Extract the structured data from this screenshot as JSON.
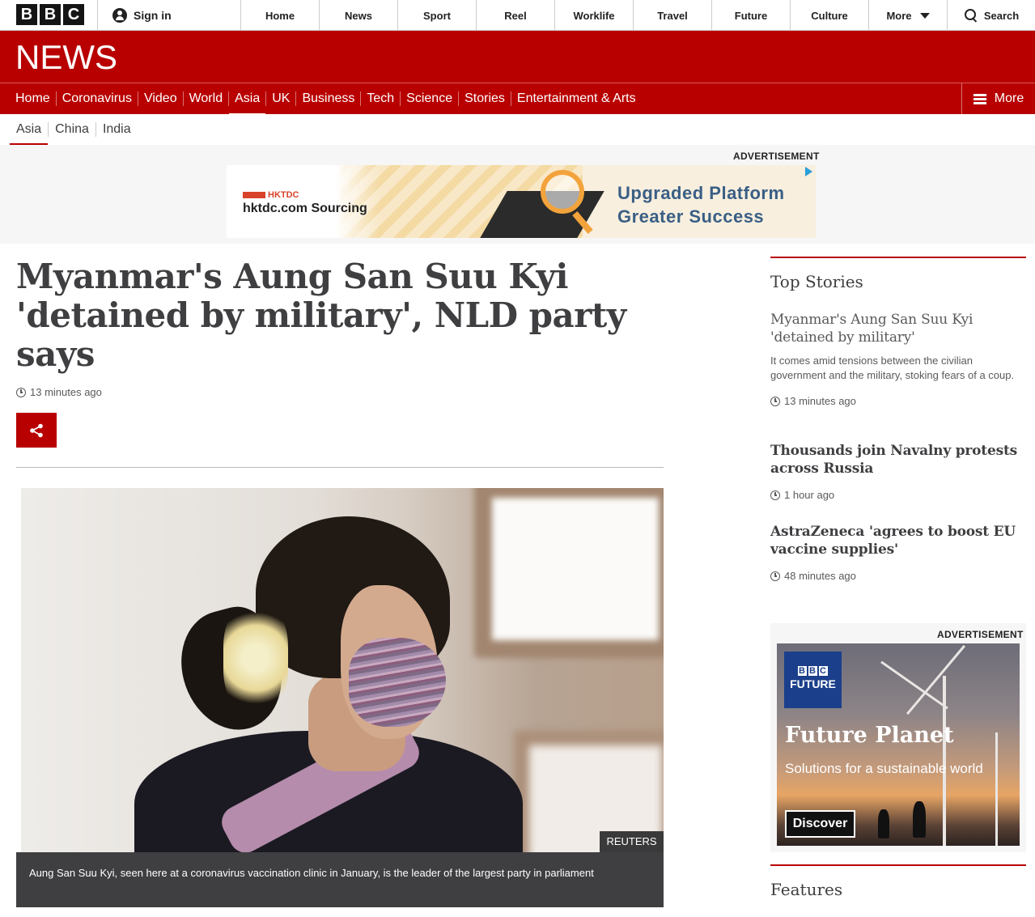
{
  "global_nav": {
    "logo_letters": [
      "B",
      "B",
      "C"
    ],
    "sign_in": "Sign in",
    "items": [
      "Home",
      "News",
      "Sport",
      "Reel",
      "Worklife",
      "Travel",
      "Future",
      "Culture"
    ],
    "more": "More",
    "search": "Search"
  },
  "masthead": {
    "title": "NEWS"
  },
  "section_nav": {
    "items": [
      "Home",
      "Coronavirus",
      "Video",
      "World",
      "Asia",
      "UK",
      "Business",
      "Tech",
      "Science",
      "Stories",
      "Entertainment & Arts"
    ],
    "active": "Asia",
    "more": "More"
  },
  "sub_nav": {
    "items": [
      "Asia",
      "China",
      "India"
    ],
    "active": "Asia"
  },
  "top_ad": {
    "label": "ADVERTISEMENT",
    "brand_mark": "HKTDC",
    "brand": "hktdc.com Sourcing",
    "lines": [
      "Upgraded Platform",
      "Greater Success"
    ]
  },
  "article": {
    "headline": "Myanmar's Aung San Suu Kyi 'detained by military', NLD party says",
    "timestamp": "13 minutes ago",
    "image_credit": "REUTERS",
    "caption": "Aung San Suu Kyi, seen here at a coronavirus vaccination clinic in January, is the leader of the largest party in parliament"
  },
  "sidebar": {
    "top_stories_title": "Top Stories",
    "stories": [
      {
        "title": "Myanmar's Aung San Suu Kyi 'detained by military'",
        "summary": "It comes amid tensions between the civilian government and the military, stoking fears of a coup.",
        "time": "13 minutes ago"
      },
      {
        "title": "Thousands join Navalny protests across Russia",
        "time": "1 hour ago"
      },
      {
        "title": "AstraZeneca 'agrees to boost EU vaccine supplies'",
        "time": "48 minutes ago"
      }
    ],
    "ad": {
      "label": "ADVERTISEMENT",
      "logo_letters": [
        "B",
        "B",
        "C"
      ],
      "logo_word": "FUTURE",
      "title": "Future Planet",
      "subtitle": "Solutions for a sustainable world",
      "button": "Discover"
    },
    "features_title": "Features"
  },
  "colors": {
    "brand_red": "#b80000",
    "text_dark": "#3f3f42",
    "caption_bg": "#3f3f42"
  }
}
